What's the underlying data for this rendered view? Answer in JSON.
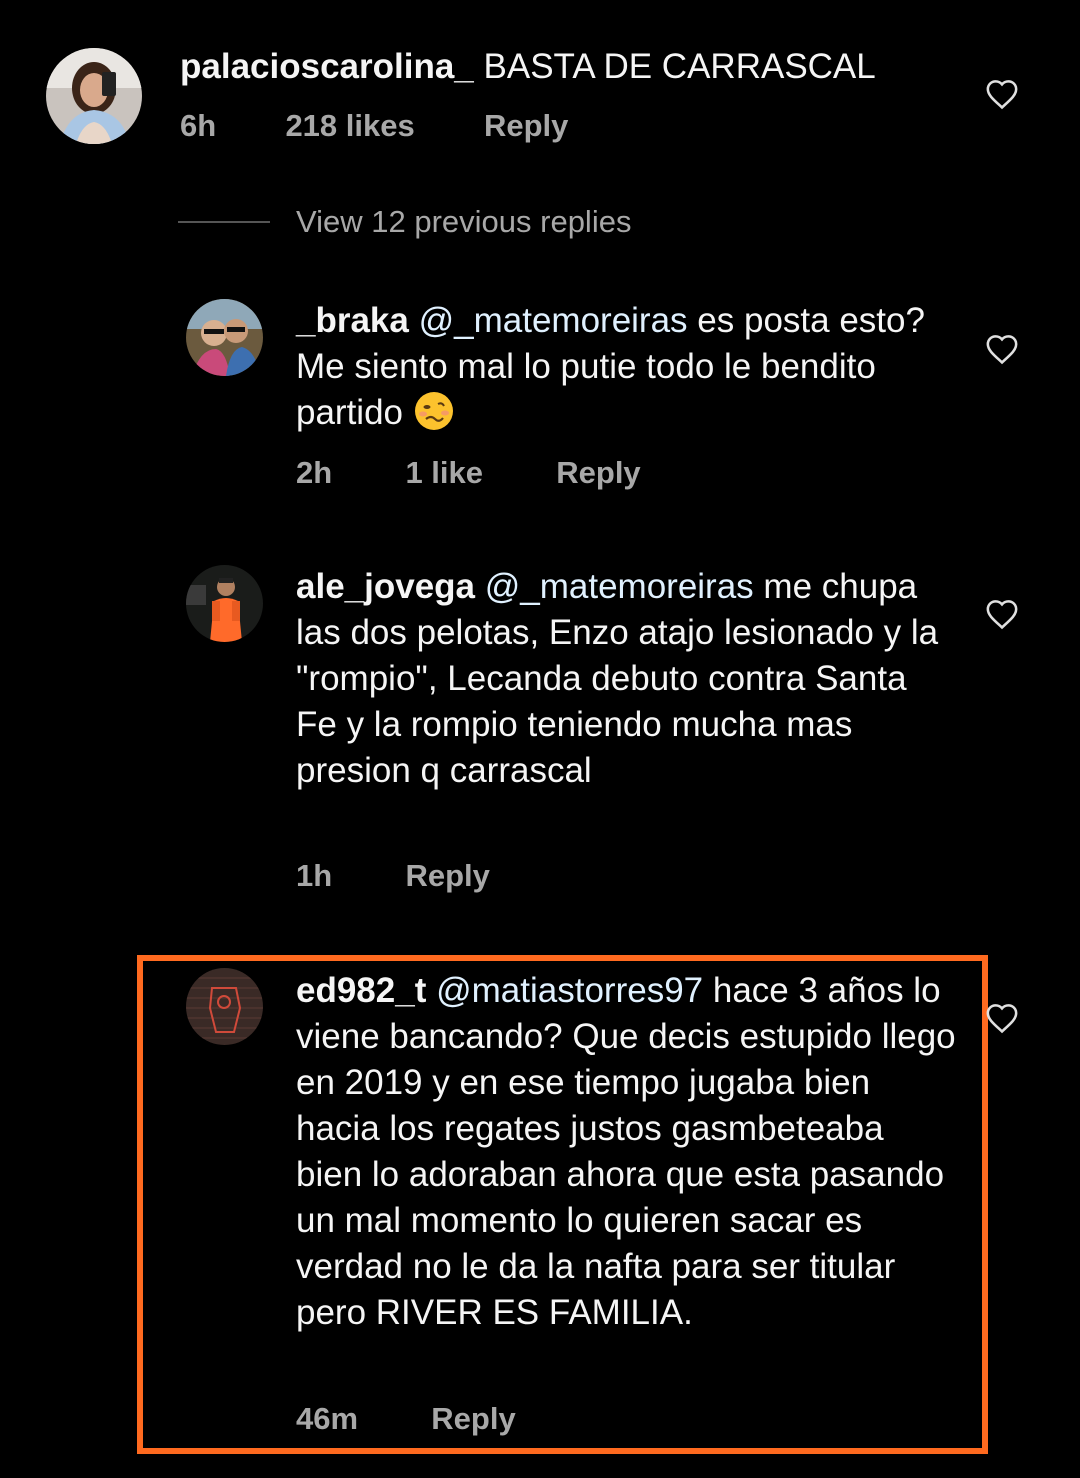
{
  "comments": [
    {
      "username": "palacioscarolina_",
      "mention": "",
      "text": "BASTA DE CARRASCAL",
      "time": "6h",
      "likes": "218 likes",
      "reply_label": "Reply",
      "avatar_icon": "user-avatar-photo",
      "like_icon": "heart-outline-icon"
    },
    {
      "username": "_braka",
      "mention": "@_matemoreiras",
      "text": "es posta esto? Me siento mal lo putie todo le bendito partido",
      "emoji": "woozy-face-emoji",
      "time": "2h",
      "likes": "1 like",
      "reply_label": "Reply",
      "avatar_icon": "user-avatar-photo",
      "like_icon": "heart-outline-icon"
    },
    {
      "username": "ale_jovega",
      "mention": "@_matemoreiras",
      "text": "me chupa las dos pelotas, Enzo atajo lesionado y la \"rompio\", Lecanda debuto contra Santa Fe y la rompio teniendo mucha mas presion q carrascal",
      "time": "1h",
      "reply_label": "Reply",
      "avatar_icon": "user-avatar-photo",
      "like_icon": "heart-outline-icon"
    },
    {
      "username": "ed982_t",
      "mention": "@matiastorres97",
      "text": "hace 3 años lo viene bancando? Que decis estupido llego en 2019 y en ese tiempo jugaba bien hacia los regates justos gasmbeteaba bien lo adoraban ahora que esta pasando un mal momento lo quieren sacar es verdad no le da la nafta para ser titular pero RIVER ES FAMILIA.",
      "time": "46m",
      "reply_label": "Reply",
      "avatar_icon": "user-avatar-photo",
      "like_icon": "heart-outline-icon"
    }
  ],
  "view_replies": "View 12 previous replies",
  "highlight_color": "#ff6a1f"
}
